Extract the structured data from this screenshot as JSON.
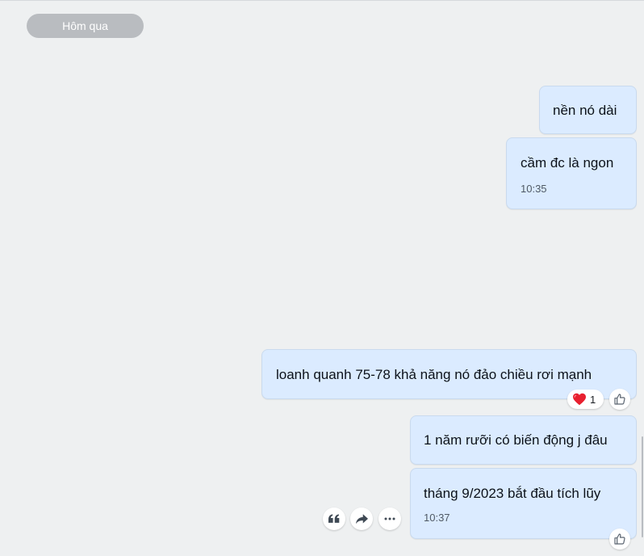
{
  "date_separator": "Hôm qua",
  "messages": [
    {
      "text": "nền nó dài",
      "time": ""
    },
    {
      "text": "cầm đc là ngon",
      "time": "10:35"
    },
    {
      "text": "loanh quanh 75-78 khả năng nó đảo chiều rơi mạnh",
      "time": "",
      "reaction": {
        "emoji": "heart-icon",
        "count": "1"
      }
    },
    {
      "text": "1 năm rưỡi có biến động j đâu",
      "time": ""
    },
    {
      "text": "tháng 9/2023 bắt đầu tích lũy",
      "time": "10:37"
    }
  ],
  "message_actions": {
    "quote_icon": "quote-icon",
    "forward_icon": "forward-icon",
    "more_icon": "more-icon"
  },
  "colors": {
    "background": "#eef0f1",
    "bubble": "#dbebff",
    "bubble_border": "#c9daee",
    "date_pill": "#b9bcc0",
    "heart": "#e8202f",
    "icon": "#5a6470"
  }
}
